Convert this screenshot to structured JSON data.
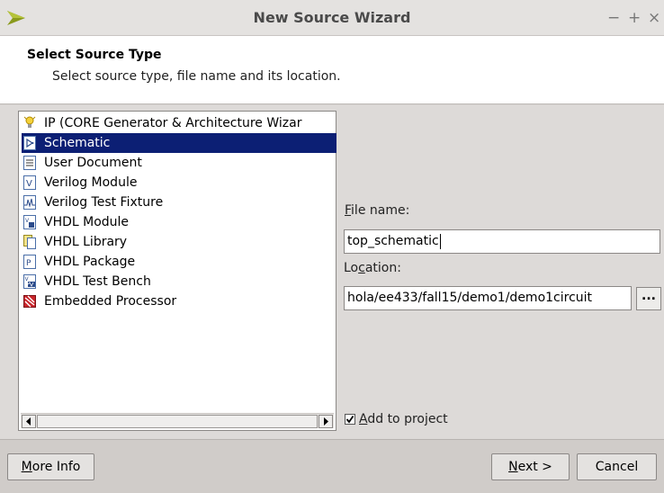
{
  "window": {
    "title": "New Source Wizard",
    "minimize_glyph": "−",
    "maximize_glyph": "+",
    "close_glyph": "×"
  },
  "header": {
    "title": "Select Source Type",
    "subtitle": "Select source type, file name and its location."
  },
  "source_types": [
    {
      "label": "IP (CORE Generator & Architecture Wizar",
      "icon": "ip-core-icon",
      "selected": false
    },
    {
      "label": "Schematic",
      "icon": "schematic-icon",
      "selected": true
    },
    {
      "label": "User Document",
      "icon": "document-icon",
      "selected": false
    },
    {
      "label": "Verilog Module",
      "icon": "verilog-module-icon",
      "selected": false
    },
    {
      "label": "Verilog Test Fixture",
      "icon": "verilog-test-fixture-icon",
      "selected": false
    },
    {
      "label": "VHDL Module",
      "icon": "vhdl-module-icon",
      "selected": false
    },
    {
      "label": "VHDL Library",
      "icon": "vhdl-library-icon",
      "selected": false
    },
    {
      "label": "VHDL Package",
      "icon": "vhdl-package-icon",
      "selected": false
    },
    {
      "label": "VHDL Test Bench",
      "icon": "vhdl-test-bench-icon",
      "selected": false
    },
    {
      "label": "Embedded Processor",
      "icon": "embedded-processor-icon",
      "selected": false
    }
  ],
  "file_name": {
    "label_first": "F",
    "label_rest": "ile name:",
    "value": "top_schematic"
  },
  "location": {
    "label_first": "Lo",
    "label_mnemonic": "c",
    "label_rest": "ation:",
    "value": "hola/ee433/fall15/demo1/demo1circuit",
    "browse_label": "..."
  },
  "add_to_project": {
    "checked": true,
    "check_glyph": "✓",
    "label_mnemonic": "A",
    "label_rest": "dd to project"
  },
  "buttons": {
    "more_info_mnemonic": "M",
    "more_info_rest": "ore Info",
    "next_mnemonic": "N",
    "next_rest": "ext >",
    "cancel": "Cancel"
  },
  "colors": {
    "selection_bg": "#0c1f74",
    "selection_fg": "#ffffff",
    "logo": "#8a9a1c"
  }
}
